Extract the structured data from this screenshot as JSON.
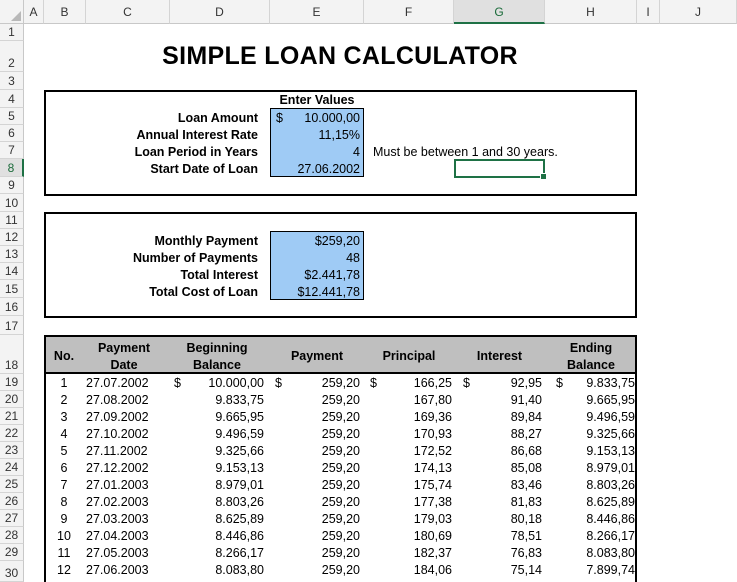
{
  "columns": [
    "A",
    "B",
    "C",
    "D",
    "E",
    "F",
    "G",
    "H",
    "I",
    "J"
  ],
  "rows": [
    "1",
    "2",
    "3",
    "4",
    "5",
    "6",
    "7",
    "8",
    "9",
    "10",
    "11",
    "12",
    "13",
    "14",
    "15",
    "16",
    "17",
    "18",
    "19",
    "20",
    "21",
    "22",
    "23",
    "24",
    "25",
    "26",
    "27",
    "28",
    "29",
    "30"
  ],
  "title": "SIMPLE LOAN CALCULATOR",
  "inputs": {
    "header": "Enter Values",
    "loan_amount_label": "Loan Amount",
    "loan_amount_currency": "$",
    "loan_amount_value": "10.000,00",
    "rate_label": "Annual Interest Rate",
    "rate_value": "11,15%",
    "period_label": "Loan Period in Years",
    "period_value": "4",
    "period_note": "Must be between 1 and 30 years.",
    "start_label": "Start Date of Loan",
    "start_value": "27.06.2002"
  },
  "summary": {
    "monthly_label": "Monthly Payment",
    "monthly_value": "$259,20",
    "num_label": "Number of Payments",
    "num_value": "48",
    "interest_label": "Total Interest",
    "interest_value": "$2.441,78",
    "cost_label": "Total Cost of Loan",
    "cost_value": "$12.441,78"
  },
  "schedule": {
    "headers": {
      "no": "No.",
      "date1": "Payment",
      "date2": "Date",
      "begin1": "Beginning",
      "begin2": "Balance",
      "payment": "Payment",
      "principal": "Principal",
      "interest": "Interest",
      "end1": "Ending",
      "end2": "Balance"
    },
    "currency": "$",
    "rows": [
      {
        "no": "1",
        "date": "27.07.2002",
        "begin": "10.000,00",
        "payment": "259,20",
        "principal": "166,25",
        "interest": "92,95",
        "end": "9.833,75"
      },
      {
        "no": "2",
        "date": "27.08.2002",
        "begin": "9.833,75",
        "payment": "259,20",
        "principal": "167,80",
        "interest": "91,40",
        "end": "9.665,95"
      },
      {
        "no": "3",
        "date": "27.09.2002",
        "begin": "9.665,95",
        "payment": "259,20",
        "principal": "169,36",
        "interest": "89,84",
        "end": "9.496,59"
      },
      {
        "no": "4",
        "date": "27.10.2002",
        "begin": "9.496,59",
        "payment": "259,20",
        "principal": "170,93",
        "interest": "88,27",
        "end": "9.325,66"
      },
      {
        "no": "5",
        "date": "27.11.2002",
        "begin": "9.325,66",
        "payment": "259,20",
        "principal": "172,52",
        "interest": "86,68",
        "end": "9.153,13"
      },
      {
        "no": "6",
        "date": "27.12.2002",
        "begin": "9.153,13",
        "payment": "259,20",
        "principal": "174,13",
        "interest": "85,08",
        "end": "8.979,01"
      },
      {
        "no": "7",
        "date": "27.01.2003",
        "begin": "8.979,01",
        "payment": "259,20",
        "principal": "175,74",
        "interest": "83,46",
        "end": "8.803,26"
      },
      {
        "no": "8",
        "date": "27.02.2003",
        "begin": "8.803,26",
        "payment": "259,20",
        "principal": "177,38",
        "interest": "81,83",
        "end": "8.625,89"
      },
      {
        "no": "9",
        "date": "27.03.2003",
        "begin": "8.625,89",
        "payment": "259,20",
        "principal": "179,03",
        "interest": "80,18",
        "end": "8.446,86"
      },
      {
        "no": "10",
        "date": "27.04.2003",
        "begin": "8.446,86",
        "payment": "259,20",
        "principal": "180,69",
        "interest": "78,51",
        "end": "8.266,17"
      },
      {
        "no": "11",
        "date": "27.05.2003",
        "begin": "8.266,17",
        "payment": "259,20",
        "principal": "182,37",
        "interest": "76,83",
        "end": "8.083,80"
      },
      {
        "no": "12",
        "date": "27.06.2003",
        "begin": "8.083,80",
        "payment": "259,20",
        "principal": "184,06",
        "interest": "75,14",
        "end": "7.899,74"
      }
    ]
  }
}
